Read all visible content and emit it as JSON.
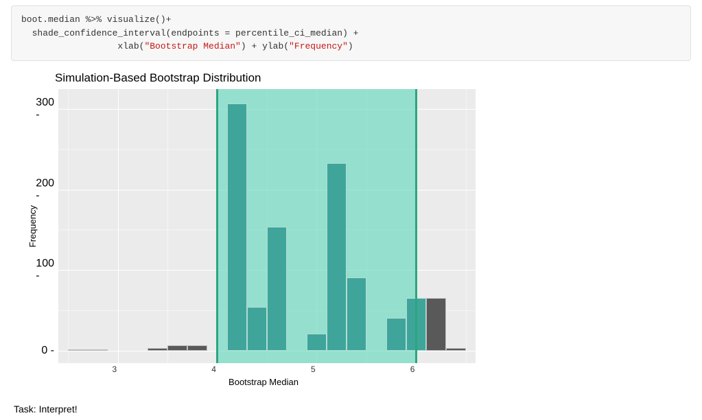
{
  "code": {
    "line1_pre": "boot.median %>% visualize()+",
    "line2_pre": "  shade_confidence_interval(endpoints = percentile_ci_median) +",
    "line3_indent": "                  xlab(",
    "line3_str1": "\"Bootstrap Median\"",
    "line3_mid": ") + ylab(",
    "line3_str2": "\"Frequency\"",
    "line3_end": ")"
  },
  "task_text": "Task: Interpret!",
  "chart_data": {
    "type": "bar",
    "title": "Simulation-Based Bootstrap Distribution",
    "xlabel": "Bootstrap Median",
    "ylabel": "Frequency",
    "x_ticks": [
      3,
      4,
      5,
      6
    ],
    "y_ticks": [
      0,
      100,
      200,
      300
    ],
    "xlim": [
      2.4,
      6.6
    ],
    "ylim": [
      -15,
      325
    ],
    "ci": {
      "lower": 4.0,
      "upper": 6.0
    },
    "bin_width": 0.2,
    "bars": [
      {
        "x": 2.6,
        "count": 1,
        "inside": false
      },
      {
        "x": 2.8,
        "count": 1,
        "inside": false
      },
      {
        "x": 3.4,
        "count": 3,
        "inside": false
      },
      {
        "x": 3.6,
        "count": 7,
        "inside": false
      },
      {
        "x": 3.8,
        "count": 7,
        "inside": false
      },
      {
        "x": 4.0,
        "count": 0,
        "inside": true
      },
      {
        "x": 4.2,
        "count": 307,
        "inside": true
      },
      {
        "x": 4.4,
        "count": 54,
        "inside": true
      },
      {
        "x": 4.6,
        "count": 154,
        "inside": true
      },
      {
        "x": 4.8,
        "count": 0,
        "inside": true
      },
      {
        "x": 5.0,
        "count": 21,
        "inside": true
      },
      {
        "x": 5.2,
        "count": 233,
        "inside": true
      },
      {
        "x": 5.4,
        "count": 91,
        "inside": true
      },
      {
        "x": 5.6,
        "count": 0,
        "inside": true
      },
      {
        "x": 5.8,
        "count": 41,
        "inside": true
      },
      {
        "x": 6.0,
        "count": 65,
        "inside": true
      },
      {
        "x": 6.2,
        "count": 65,
        "inside": false
      },
      {
        "x": 6.4,
        "count": 3,
        "inside": false
      }
    ]
  }
}
